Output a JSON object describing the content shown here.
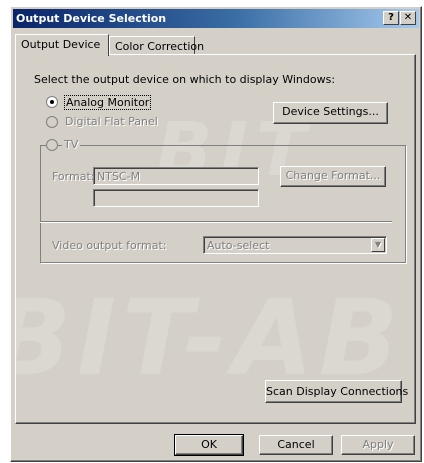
{
  "window": {
    "title": "Output Device Selection",
    "help_label": "?",
    "close_label": "✕"
  },
  "tabs": [
    {
      "label": "Output Device",
      "active": true
    },
    {
      "label": "Color Correction",
      "active": false
    }
  ],
  "panel": {
    "prompt": "Select the output device on which to display Windows:",
    "watermark_top": "BIT",
    "watermark_bottom": "BIT-AB",
    "devices": [
      {
        "label": "Analog Monitor",
        "selected": true,
        "enabled": true
      },
      {
        "label": "Digital Flat Panel",
        "selected": false,
        "enabled": false
      },
      {
        "label": "TV",
        "selected": false,
        "enabled": false
      }
    ],
    "device_settings_button": "Device Settings...",
    "format_label": "Format:",
    "format_value": "NTSC-M",
    "format_second_value": "",
    "change_format_button": "Change Format...",
    "video_output_label": "Video output format:",
    "video_output_value": "Auto-select",
    "scan_button": "Scan Display Connections"
  },
  "footer": {
    "ok": "OK",
    "cancel": "Cancel",
    "apply": "Apply"
  }
}
